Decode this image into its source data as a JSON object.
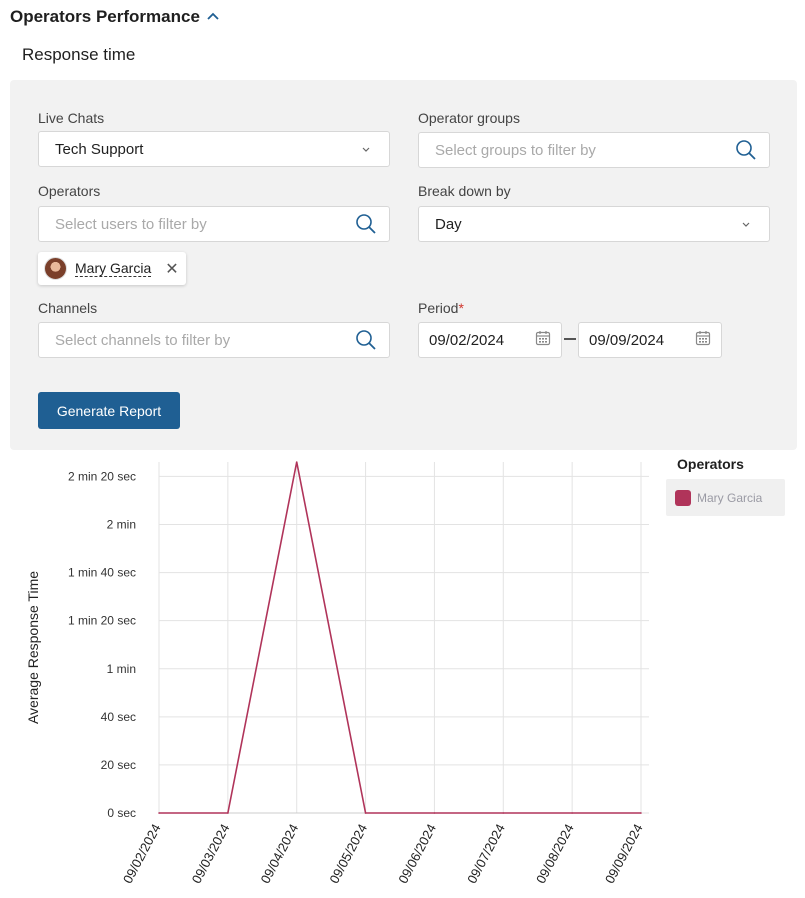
{
  "header": {
    "title": "Operators Performance"
  },
  "subsection": {
    "title": "Response time"
  },
  "filters": {
    "live_chats": {
      "label": "Live Chats",
      "value": "Tech Support"
    },
    "operator_groups": {
      "label": "Operator groups",
      "placeholder": "Select groups to filter by"
    },
    "operators": {
      "label": "Operators",
      "placeholder": "Select users to filter by",
      "selected": [
        {
          "name": "Mary Garcia"
        }
      ]
    },
    "break_down_by": {
      "label": "Break down by",
      "value": "Day"
    },
    "channels": {
      "label": "Channels",
      "placeholder": "Select channels to filter by"
    },
    "period": {
      "label": "Period",
      "required_mark": "*",
      "start": "09/02/2024",
      "end": "09/09/2024"
    }
  },
  "actions": {
    "generate_label": "Generate Report"
  },
  "legend": {
    "title": "Operators",
    "items": [
      {
        "name": "Mary Garcia",
        "color": "#b0345a"
      }
    ]
  },
  "chart_data": {
    "type": "line",
    "ylabel": "Average Response Time",
    "x": [
      "09/02/2024",
      "09/03/2024",
      "09/04/2024",
      "09/05/2024",
      "09/06/2024",
      "09/07/2024",
      "09/08/2024",
      "09/09/2024"
    ],
    "y_ticks": [
      {
        "value": 0,
        "label": "0 sec"
      },
      {
        "value": 20,
        "label": "20 sec"
      },
      {
        "value": 40,
        "label": "40 sec"
      },
      {
        "value": 60,
        "label": "1 min"
      },
      {
        "value": 80,
        "label": "1 min 20 sec"
      },
      {
        "value": 100,
        "label": "1 min 40 sec"
      },
      {
        "value": 120,
        "label": "2 min"
      },
      {
        "value": 140,
        "label": "2 min 20 sec"
      }
    ],
    "ylim": [
      0,
      146
    ],
    "grid": true,
    "legend_position": "right",
    "series": [
      {
        "name": "Mary Garcia",
        "color": "#b0345a",
        "values": [
          0,
          0,
          146,
          0,
          0,
          0,
          0,
          0
        ]
      }
    ]
  },
  "colors": {
    "accent": "#1f5f93",
    "panel": "#f2f2f2",
    "series": "#b0345a"
  },
  "icons": {
    "search": "search-icon",
    "dropdown": "chevron-down-icon",
    "calendar": "calendar-icon",
    "remove": "close-icon",
    "collapse": "chevron-up-icon"
  }
}
